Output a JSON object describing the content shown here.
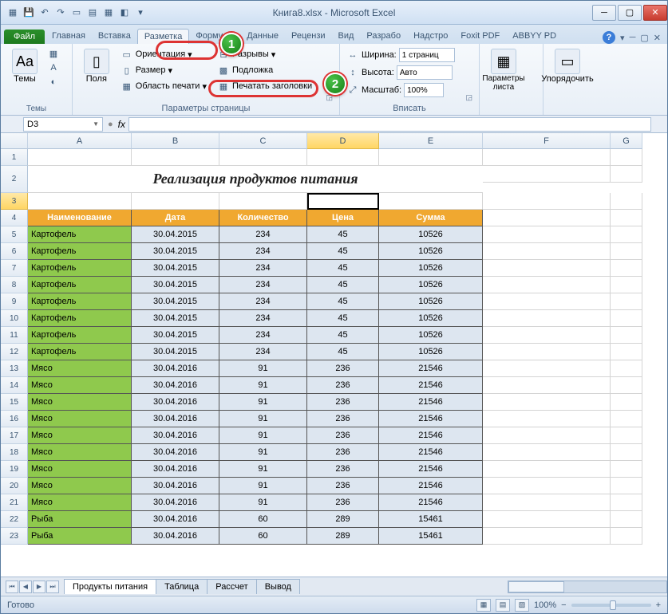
{
  "window": {
    "title": "Книга8.xlsx - Microsoft Excel"
  },
  "tabs": {
    "file": "Файл",
    "list": [
      "Главная",
      "Вставка",
      "Разметка",
      "Формулы",
      "Данные",
      "Рецензи",
      "Вид",
      "Разрабо",
      "Надстро",
      "Foxit PDF",
      "ABBYY PD"
    ],
    "active": 2
  },
  "ribbon": {
    "themes": {
      "label": "Темы",
      "btn": "Темы"
    },
    "page": {
      "label": "Параметры страницы",
      "margins": "Поля",
      "orient": "Ориентация",
      "size": "Размер",
      "area": "Область печати",
      "breaks": "Разрывы",
      "bg": "Подложка",
      "titles": "Печатать заголовки"
    },
    "fit": {
      "label": "Вписать",
      "w": "Ширина:",
      "h": "Высота:",
      "s": "Масштаб:",
      "wv": "1 страниц",
      "hv": "Авто",
      "sv": "100%"
    },
    "sheet": {
      "label": "",
      "opts": "Параметры листа"
    },
    "arrange": {
      "btn": "Упорядочить"
    }
  },
  "namebox": "D3",
  "fx": "fx",
  "cols": [
    "A",
    "B",
    "C",
    "D",
    "E",
    "F",
    "G"
  ],
  "sheet_title": "Реализация продуктов питания",
  "headers": [
    "Наименование",
    "Дата",
    "Количество",
    "Цена",
    "Сумма"
  ],
  "rows": [
    {
      "r": 5,
      "n": "Картофель",
      "d": "30.04.2015",
      "q": "234",
      "p": "45",
      "s": "10526"
    },
    {
      "r": 6,
      "n": "Картофель",
      "d": "30.04.2015",
      "q": "234",
      "p": "45",
      "s": "10526"
    },
    {
      "r": 7,
      "n": "Картофель",
      "d": "30.04.2015",
      "q": "234",
      "p": "45",
      "s": "10526"
    },
    {
      "r": 8,
      "n": "Картофель",
      "d": "30.04.2015",
      "q": "234",
      "p": "45",
      "s": "10526"
    },
    {
      "r": 9,
      "n": "Картофель",
      "d": "30.04.2015",
      "q": "234",
      "p": "45",
      "s": "10526"
    },
    {
      "r": 10,
      "n": "Картофель",
      "d": "30.04.2015",
      "q": "234",
      "p": "45",
      "s": "10526"
    },
    {
      "r": 11,
      "n": "Картофель",
      "d": "30.04.2015",
      "q": "234",
      "p": "45",
      "s": "10526"
    },
    {
      "r": 12,
      "n": "Картофель",
      "d": "30.04.2015",
      "q": "234",
      "p": "45",
      "s": "10526"
    },
    {
      "r": 13,
      "n": "Мясо",
      "d": "30.04.2016",
      "q": "91",
      "p": "236",
      "s": "21546"
    },
    {
      "r": 14,
      "n": "Мясо",
      "d": "30.04.2016",
      "q": "91",
      "p": "236",
      "s": "21546"
    },
    {
      "r": 15,
      "n": "Мясо",
      "d": "30.04.2016",
      "q": "91",
      "p": "236",
      "s": "21546"
    },
    {
      "r": 16,
      "n": "Мясо",
      "d": "30.04.2016",
      "q": "91",
      "p": "236",
      "s": "21546"
    },
    {
      "r": 17,
      "n": "Мясо",
      "d": "30.04.2016",
      "q": "91",
      "p": "236",
      "s": "21546"
    },
    {
      "r": 18,
      "n": "Мясо",
      "d": "30.04.2016",
      "q": "91",
      "p": "236",
      "s": "21546"
    },
    {
      "r": 19,
      "n": "Мясо",
      "d": "30.04.2016",
      "q": "91",
      "p": "236",
      "s": "21546"
    },
    {
      "r": 20,
      "n": "Мясо",
      "d": "30.04.2016",
      "q": "91",
      "p": "236",
      "s": "21546"
    },
    {
      "r": 21,
      "n": "Мясо",
      "d": "30.04.2016",
      "q": "91",
      "p": "236",
      "s": "21546"
    },
    {
      "r": 22,
      "n": "Рыба",
      "d": "30.04.2016",
      "q": "60",
      "p": "289",
      "s": "15461"
    },
    {
      "r": 23,
      "n": "Рыба",
      "d": "30.04.2016",
      "q": "60",
      "p": "289",
      "s": "15461"
    }
  ],
  "sheets": [
    "Продукты питания",
    "Таблица",
    "Рассчет",
    "Вывод"
  ],
  "status": {
    "ready": "Готово",
    "zoom": "100%"
  },
  "callouts": {
    "c1": "1",
    "c2": "2"
  }
}
